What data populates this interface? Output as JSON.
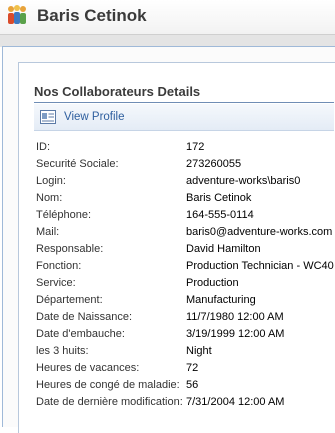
{
  "site": {
    "title": "Baris Cetinok"
  },
  "webpart": {
    "title": "Nos Collaborateurs Details"
  },
  "toolbar": {
    "view_profile_label": "View Profile"
  },
  "fields": [
    {
      "label": "ID:",
      "value": "172"
    },
    {
      "label": "Securité Sociale:",
      "value": "273260055"
    },
    {
      "label": "Login:",
      "value": "adventure-works\\baris0"
    },
    {
      "label": "Nom:",
      "value": "Baris Cetinok"
    },
    {
      "label": "Téléphone:",
      "value": "164-555-0114"
    },
    {
      "label": "Mail:",
      "value": "baris0@adventure-works.com"
    },
    {
      "label": "Responsable:",
      "value": "David Hamilton"
    },
    {
      "label": "Fonction:",
      "value": "Production Technician - WC40"
    },
    {
      "label": "Service:",
      "value": "Production"
    },
    {
      "label": "Département:",
      "value": "Manufacturing"
    },
    {
      "label": "Date de Naissance:",
      "value": "11/7/1980 12:00 AM"
    },
    {
      "label": "Date d'embauche:",
      "value": "3/19/1999 12:00 AM"
    },
    {
      "label": "les 3 huits:",
      "value": "Night"
    },
    {
      "label": "Heures de vacances:",
      "value": "72"
    },
    {
      "label": "Heures de congé de maladie:",
      "value": "56"
    },
    {
      "label": "Date de dernière modification:",
      "value": "7/31/2004 12:00 AM"
    }
  ]
}
